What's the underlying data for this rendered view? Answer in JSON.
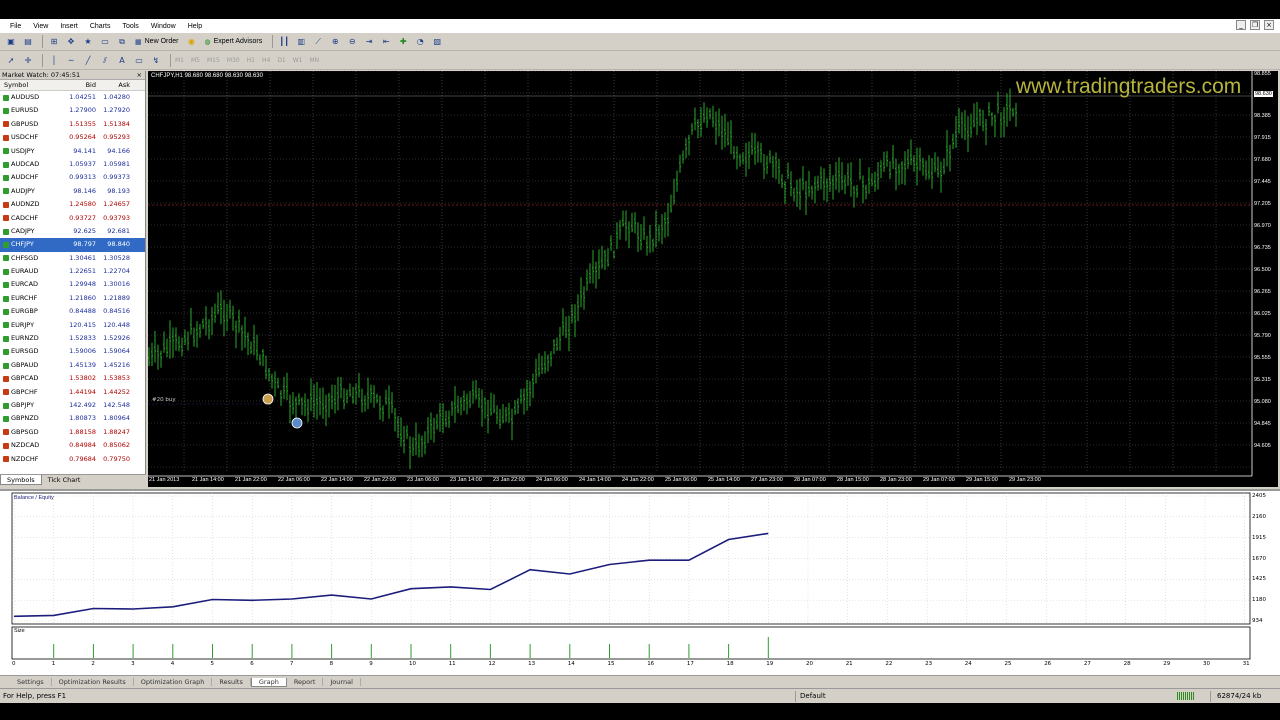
{
  "menu": [
    "File",
    "View",
    "Insert",
    "Charts",
    "Tools",
    "Window",
    "Help"
  ],
  "toolbar": {
    "new_order": "New Order",
    "expert_advisors": "Expert Advisors",
    "timeframes": [
      "M1",
      "M5",
      "M15",
      "M30",
      "H1",
      "H4",
      "D1",
      "W1",
      "MN"
    ]
  },
  "market_watch": {
    "title": "Market Watch: 07:45:51",
    "columns": [
      "Symbol",
      "Bid",
      "Ask"
    ],
    "rows": [
      {
        "symbol": "AUDUSD",
        "bid": "1.04251",
        "ask": "1.04280",
        "dir": "up"
      },
      {
        "symbol": "EURUSD",
        "bid": "1.27900",
        "ask": "1.27920",
        "dir": "up"
      },
      {
        "symbol": "GBPUSD",
        "bid": "1.51355",
        "ask": "1.51384",
        "dir": "down"
      },
      {
        "symbol": "USDCHF",
        "bid": "0.95264",
        "ask": "0.95293",
        "dir": "down"
      },
      {
        "symbol": "USDJPY",
        "bid": "94.141",
        "ask": "94.166",
        "dir": "up"
      },
      {
        "symbol": "AUDCAD",
        "bid": "1.05937",
        "ask": "1.05981",
        "dir": "up"
      },
      {
        "symbol": "AUDCHF",
        "bid": "0.99313",
        "ask": "0.99373",
        "dir": "up"
      },
      {
        "symbol": "AUDJPY",
        "bid": "98.146",
        "ask": "98.193",
        "dir": "up"
      },
      {
        "symbol": "AUDNZD",
        "bid": "1.24580",
        "ask": "1.24657",
        "dir": "down"
      },
      {
        "symbol": "CADCHF",
        "bid": "0.93727",
        "ask": "0.93793",
        "dir": "down"
      },
      {
        "symbol": "CADJPY",
        "bid": "92.625",
        "ask": "92.681",
        "dir": "up"
      },
      {
        "symbol": "CHFJPY",
        "bid": "98.797",
        "ask": "98.840",
        "dir": "up",
        "selected": true
      },
      {
        "symbol": "CHFSGD",
        "bid": "1.30461",
        "ask": "1.30528",
        "dir": "up"
      },
      {
        "symbol": "EURAUD",
        "bid": "1.22651",
        "ask": "1.22704",
        "dir": "up"
      },
      {
        "symbol": "EURCAD",
        "bid": "1.29948",
        "ask": "1.30016",
        "dir": "up"
      },
      {
        "symbol": "EURCHF",
        "bid": "1.21860",
        "ask": "1.21889",
        "dir": "up"
      },
      {
        "symbol": "EURGBP",
        "bid": "0.84488",
        "ask": "0.84516",
        "dir": "up"
      },
      {
        "symbol": "EURJPY",
        "bid": "120.415",
        "ask": "120.448",
        "dir": "up"
      },
      {
        "symbol": "EURNZD",
        "bid": "1.52833",
        "ask": "1.52926",
        "dir": "up"
      },
      {
        "symbol": "EURSGD",
        "bid": "1.59006",
        "ask": "1.59064",
        "dir": "up"
      },
      {
        "symbol": "GBPAUD",
        "bid": "1.45139",
        "ask": "1.45216",
        "dir": "up"
      },
      {
        "symbol": "GBPCAD",
        "bid": "1.53802",
        "ask": "1.53853",
        "dir": "down"
      },
      {
        "symbol": "GBPCHF",
        "bid": "1.44194",
        "ask": "1.44252",
        "dir": "down"
      },
      {
        "symbol": "GBPJPY",
        "bid": "142.492",
        "ask": "142.548",
        "dir": "up"
      },
      {
        "symbol": "GBPNZD",
        "bid": "1.80873",
        "ask": "1.80964",
        "dir": "up"
      },
      {
        "symbol": "GBPSGD",
        "bid": "1.88158",
        "ask": "1.88247",
        "dir": "down"
      },
      {
        "symbol": "NZDCAD",
        "bid": "0.84984",
        "ask": "0.85062",
        "dir": "down"
      },
      {
        "symbol": "NZDCHF",
        "bid": "0.79684",
        "ask": "0.79750",
        "dir": "down"
      }
    ],
    "tabs": [
      "Symbols",
      "Tick Chart"
    ]
  },
  "chart": {
    "info": "CHFJPY,H1  98.680 98.680 98.630 98.630",
    "watermark": "www.tradingtraders.com",
    "order_label": "#20 buy",
    "price_labels": [
      "98.855",
      "98.630",
      "98.385",
      "97.915",
      "97.680",
      "97.445",
      "97.205",
      "96.970",
      "96.735",
      "96.500",
      "96.265",
      "96.025",
      "95.790",
      "95.555",
      "95.315",
      "95.080",
      "94.845",
      "94.605"
    ],
    "current_price": "98.630",
    "time_labels": [
      "21 Jan 2013",
      "21 Jan 14:00",
      "21 Jan 22:00",
      "22 Jan 06:00",
      "22 Jan 14:00",
      "22 Jan 22:00",
      "23 Jan 06:00",
      "23 Jan 14:00",
      "23 Jan 22:00",
      "24 Jan 06:00",
      "24 Jan 14:00",
      "24 Jan 22:00",
      "25 Jan 06:00",
      "25 Jan 14:00",
      "27 Jan 23:00",
      "28 Jan 07:00",
      "28 Jan 15:00",
      "28 Jan 23:00",
      "29 Jan 07:00",
      "29 Jan 15:00",
      "29 Jan 23:00"
    ],
    "candle_color": "#27a827",
    "bg_color": "#000000"
  },
  "tester": {
    "legend": "Balance / Equity",
    "size_label": "Size",
    "y_labels": [
      "2405",
      "2160",
      "1915",
      "1670",
      "1425",
      "1180",
      "934"
    ],
    "x_labels": [
      "0",
      "1",
      "2",
      "3",
      "4",
      "5",
      "6",
      "7",
      "8",
      "9",
      "10",
      "11",
      "12",
      "13",
      "14",
      "15",
      "16",
      "17",
      "18",
      "19",
      "20",
      "21",
      "22",
      "23",
      "24",
      "25",
      "26",
      "27",
      "28",
      "29",
      "30",
      "31"
    ],
    "tabs": [
      "Settings",
      "Optimization Results",
      "Optimization Graph",
      "Results",
      "Graph",
      "Report",
      "Journal"
    ],
    "active_tab": "Graph",
    "line_color": "#1c1c7c"
  },
  "chart_data": {
    "type": "line",
    "title": "Balance / Equity",
    "x": [
      0,
      1,
      2,
      3,
      4,
      5,
      6,
      7,
      8,
      9,
      10,
      11,
      12,
      13,
      14,
      15,
      16,
      17,
      18,
      19
    ],
    "series": [
      {
        "name": "Balance",
        "values": [
          1000,
          1010,
          1090,
          1085,
          1110,
          1195,
          1185,
          1200,
          1245,
          1200,
          1320,
          1340,
          1310,
          1540,
          1490,
          1600,
          1650,
          1650,
          1890,
          1960
        ]
      }
    ],
    "size_values": [
      0,
      1,
      1,
      1,
      1,
      1,
      1,
      1,
      1,
      1,
      1,
      1,
      1,
      1,
      1,
      1,
      1,
      1,
      1,
      1.5
    ],
    "ylim": [
      934,
      2405
    ],
    "xlim": [
      0,
      31
    ]
  },
  "status": {
    "help": "For Help, press F1",
    "profile": "Default",
    "traffic": "62874/24 kb"
  }
}
